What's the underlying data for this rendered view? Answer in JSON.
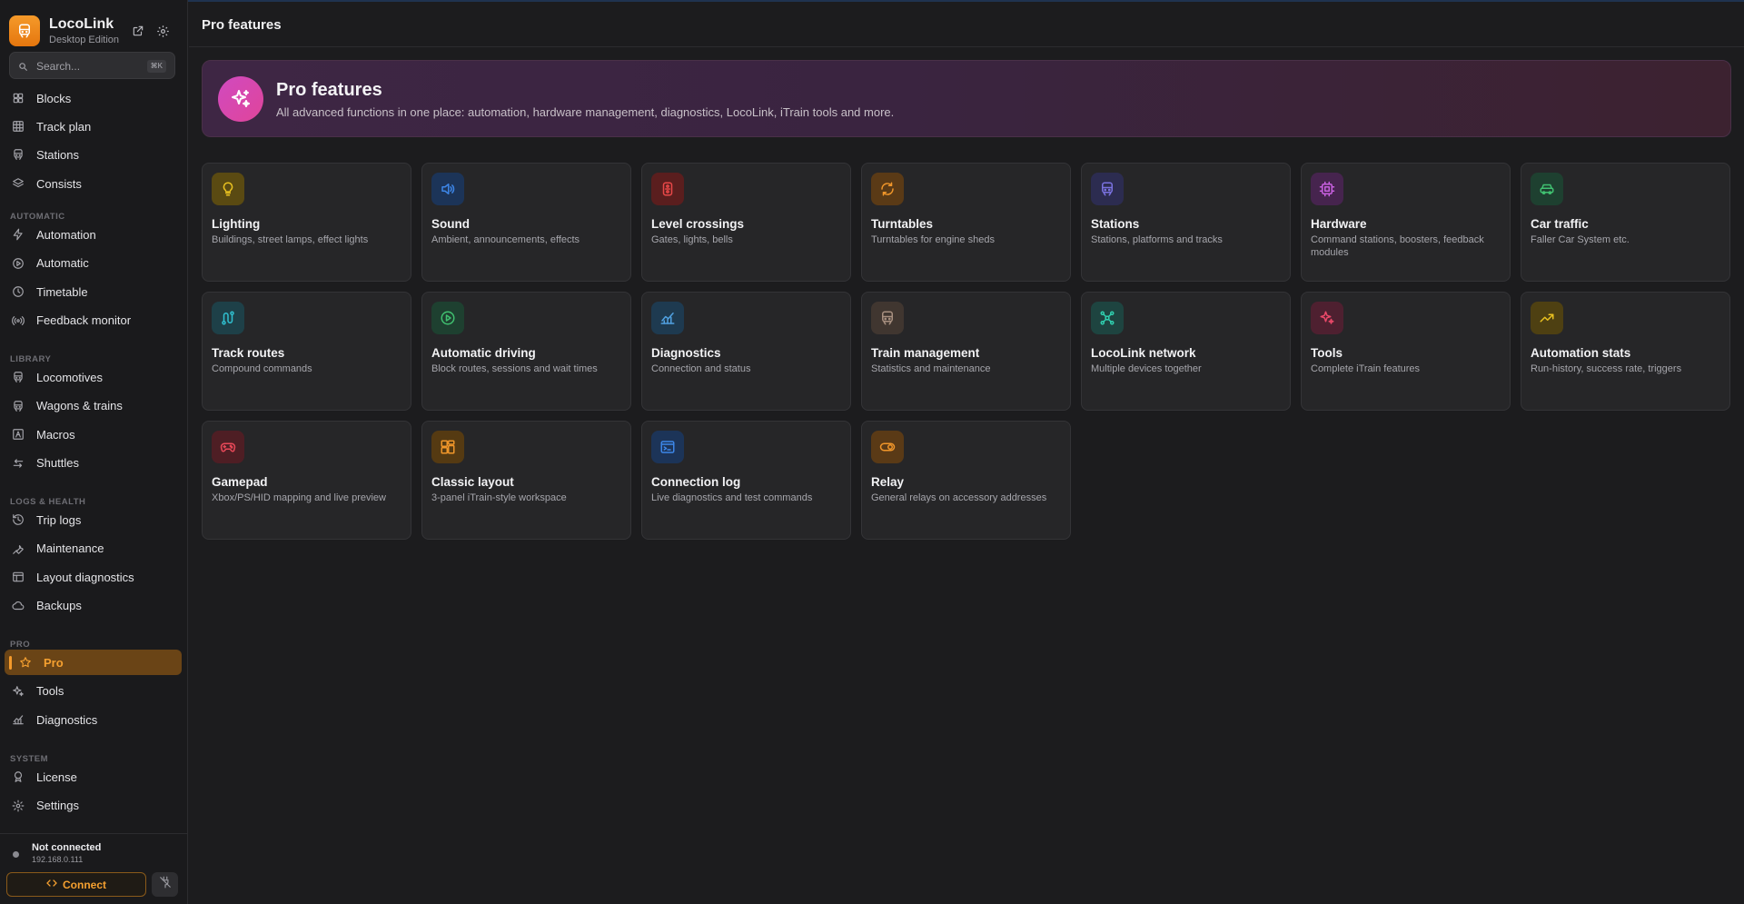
{
  "app": {
    "name": "LocoLink",
    "edition": "Desktop Edition"
  },
  "search": {
    "placeholder": "Search...",
    "shortcut": "⌘K"
  },
  "sidebar": {
    "top_items": [
      {
        "label": "Blocks",
        "icon": "blocks-icon"
      },
      {
        "label": "Track plan",
        "icon": "grid-icon"
      },
      {
        "label": "Stations",
        "icon": "train-icon"
      },
      {
        "label": "Consists",
        "icon": "layers-icon"
      }
    ],
    "sections": [
      {
        "title": "AUTOMATIC",
        "items": [
          {
            "label": "Automation",
            "icon": "bolt-icon"
          },
          {
            "label": "Automatic",
            "icon": "play-circle-icon"
          },
          {
            "label": "Timetable",
            "icon": "clock-icon"
          },
          {
            "label": "Feedback monitor",
            "icon": "radio-icon"
          }
        ]
      },
      {
        "title": "LIBRARY",
        "items": [
          {
            "label": "Locomotives",
            "icon": "train-icon"
          },
          {
            "label": "Wagons & trains",
            "icon": "train-icon"
          },
          {
            "label": "Macros",
            "icon": "macro-icon"
          },
          {
            "label": "Shuttles",
            "icon": "arrows-icon"
          }
        ]
      },
      {
        "title": "LOGS & HEALTH",
        "items": [
          {
            "label": "Trip logs",
            "icon": "history-icon"
          },
          {
            "label": "Maintenance",
            "icon": "wrench-icon"
          },
          {
            "label": "Layout diagnostics",
            "icon": "table-icon"
          },
          {
            "label": "Backups",
            "icon": "cloud-icon"
          }
        ]
      },
      {
        "title": "PRO",
        "items": [
          {
            "label": "Pro",
            "icon": "star-icon",
            "active": true
          },
          {
            "label": "Tools",
            "icon": "sparkles-icon"
          },
          {
            "label": "Diagnostics",
            "icon": "chart-icon"
          }
        ]
      },
      {
        "title": "SYSTEM",
        "items": [
          {
            "label": "License",
            "icon": "badge-icon"
          },
          {
            "label": "Settings",
            "icon": "gear-icon"
          }
        ]
      }
    ]
  },
  "connection": {
    "status": "Not connected",
    "ip": "192.168.0.111",
    "connect_label": "Connect"
  },
  "page": {
    "title": "Pro features"
  },
  "hero": {
    "title": "Pro features",
    "subtitle": "All advanced functions in one place: automation, hardware management, diagnostics, LocoLink, iTrain tools and more."
  },
  "features": [
    {
      "title": "Lighting",
      "desc": "Buildings, street lamps, effect lights",
      "icon": "lightbulb-icon",
      "bg": "#5a4a12",
      "fg": "#e8c020"
    },
    {
      "title": "Sound",
      "desc": "Ambient, announcements, effects",
      "icon": "speaker-icon",
      "bg": "#1c3458",
      "fg": "#3d86e8"
    },
    {
      "title": "Level crossings",
      "desc": "Gates, lights, bells",
      "icon": "crossing-icon",
      "bg": "#5a1e1e",
      "fg": "#e84848"
    },
    {
      "title": "Turntables",
      "desc": "Turntables for engine sheds",
      "icon": "rotate-icon",
      "bg": "#5a3a16",
      "fg": "#f0962a"
    },
    {
      "title": "Stations",
      "desc": "Stations, platforms and tracks",
      "icon": "train-icon",
      "bg": "#2c2c50",
      "fg": "#7a72e0"
    },
    {
      "title": "Hardware",
      "desc": "Command stations, boosters, feedback modules",
      "icon": "chip-icon",
      "bg": "#46244e",
      "fg": "#c860e0"
    },
    {
      "title": "Car traffic",
      "desc": "Faller Car System etc.",
      "icon": "car-icon",
      "bg": "#1e4030",
      "fg": "#40c070"
    },
    {
      "title": "Track routes",
      "desc": "Compound commands",
      "icon": "route-icon",
      "bg": "#1e4048",
      "fg": "#30c0d0"
    },
    {
      "title": "Automatic driving",
      "desc": "Block routes, sessions and wait times",
      "icon": "play-circle-icon",
      "bg": "#1e4030",
      "fg": "#40c070"
    },
    {
      "title": "Diagnostics",
      "desc": "Connection and status",
      "icon": "chart-icon",
      "bg": "#1e3a50",
      "fg": "#50a0e0"
    },
    {
      "title": "Train management",
      "desc": "Statistics and maintenance",
      "icon": "train-icon",
      "bg": "#403630",
      "fg": "#a89080"
    },
    {
      "title": "LocoLink network",
      "desc": "Multiple devices together",
      "icon": "network-icon",
      "bg": "#1e4440",
      "fg": "#30d0b0"
    },
    {
      "title": "Tools",
      "desc": "Complete iTrain features",
      "icon": "sparkles-icon",
      "bg": "#4e2030",
      "fg": "#e84868"
    },
    {
      "title": "Automation stats",
      "desc": "Run-history, success rate, triggers",
      "icon": "trend-icon",
      "bg": "#4e4012",
      "fg": "#e8c020"
    },
    {
      "title": "Gamepad",
      "desc": "Xbox/PS/HID mapping and live preview",
      "icon": "gamepad-icon",
      "bg": "#4e1e24",
      "fg": "#e84858"
    },
    {
      "title": "Classic layout",
      "desc": "3-panel iTrain-style workspace",
      "icon": "layout-icon",
      "bg": "#553a12",
      "fg": "#f0962a"
    },
    {
      "title": "Connection log",
      "desc": "Live diagnostics and test commands",
      "icon": "terminal-icon",
      "bg": "#1c3458",
      "fg": "#3d86e8"
    },
    {
      "title": "Relay",
      "desc": "General relays on accessory addresses",
      "icon": "toggle-icon",
      "bg": "#5a3a16",
      "fg": "#f0962a"
    }
  ]
}
